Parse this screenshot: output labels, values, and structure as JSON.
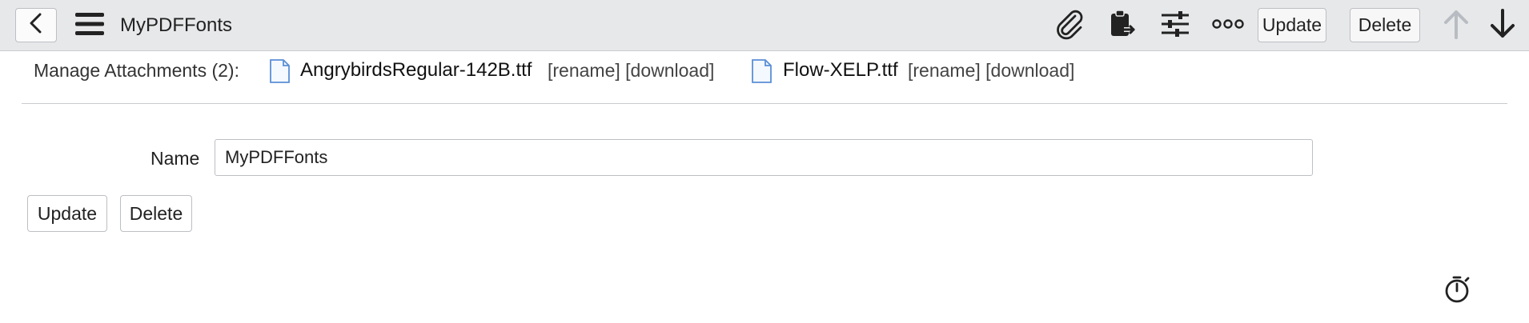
{
  "header": {
    "title": "MyPDFFonts",
    "icons": [
      "back-icon",
      "hamburger-menu-icon",
      "paperclip-icon",
      "clipboard-icon",
      "sliders-icon",
      "more-icon",
      "arrow-up-icon",
      "arrow-down-icon"
    ],
    "update_label": "Update",
    "delete_label": "Delete"
  },
  "attachments": {
    "label": "Manage Attachments (2):",
    "files": [
      {
        "name": "AngrybirdsRegular-142B.ttf",
        "rename": "[rename]",
        "download": "[download]"
      },
      {
        "name": "Flow-XELP.ttf",
        "rename": "[rename]",
        "download": "[download]"
      }
    ]
  },
  "form": {
    "name_label": "Name",
    "name_value": "MyPDFFonts",
    "update_label": "Update",
    "delete_label": "Delete"
  },
  "footer": {
    "icon": "stopwatch-icon"
  },
  "colors": {
    "header_bg": "#e7e8ea",
    "border": "#bdbfc3",
    "disabled_arrow": "#b8bcc2",
    "file_icon": "#5b8fd6"
  }
}
